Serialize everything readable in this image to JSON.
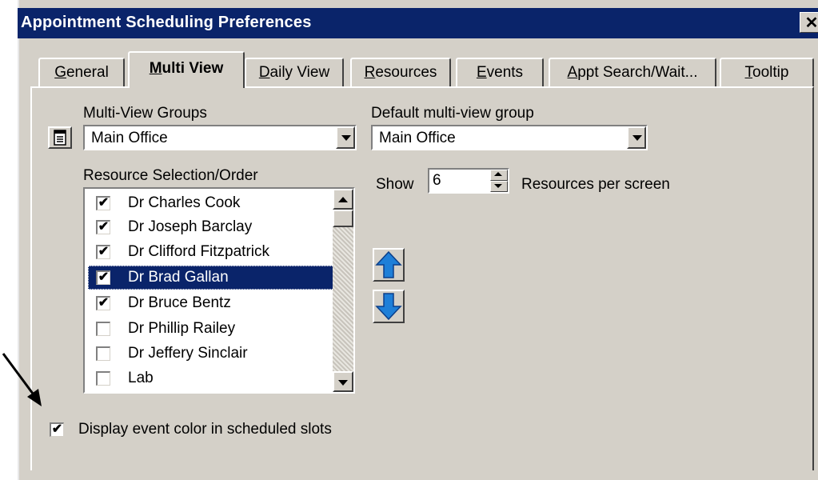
{
  "window": {
    "title": "Appointment Scheduling Preferences",
    "close_label": "✕"
  },
  "tabs": [
    {
      "label": "General",
      "mnemonic": "G",
      "rest": "eneral",
      "active": false
    },
    {
      "label": "Multi View",
      "mnemonic": "M",
      "rest": "ulti View",
      "active": true
    },
    {
      "label": "Daily View",
      "mnemonic": "D",
      "rest": "aily View",
      "active": false
    },
    {
      "label": "Resources",
      "mnemonic": "R",
      "rest": "esources",
      "active": false
    },
    {
      "label": "Events",
      "mnemonic": "E",
      "rest": "vents",
      "active": false
    },
    {
      "label": "Appt Search/Wait...",
      "mnemonic": "A",
      "rest": "ppt Search/Wait...",
      "active": false
    },
    {
      "label": "Tooltip",
      "mnemonic": "T",
      "rest": "ooltip",
      "active": false
    }
  ],
  "multi_view_groups": {
    "label": "Multi-View Groups",
    "value": "Main Office",
    "icon": "list-edit-icon"
  },
  "default_group": {
    "label": "Default multi-view group",
    "value": "Main Office"
  },
  "resource_selection": {
    "label": "Resource Selection/Order",
    "items": [
      {
        "label": "Dr Charles Cook",
        "checked": true,
        "selected": false
      },
      {
        "label": "Dr Joseph Barclay",
        "checked": true,
        "selected": false
      },
      {
        "label": "Dr Clifford Fitzpatrick",
        "checked": true,
        "selected": false
      },
      {
        "label": "Dr Brad Gallan",
        "checked": true,
        "selected": true
      },
      {
        "label": "Dr Bruce Bentz",
        "checked": true,
        "selected": false
      },
      {
        "label": "Dr Phillip Railey",
        "checked": false,
        "selected": false
      },
      {
        "label": "Dr Jeffery Sinclair",
        "checked": false,
        "selected": false
      },
      {
        "label": "Lab",
        "checked": false,
        "selected": false
      }
    ]
  },
  "show_resources": {
    "prefix": "Show",
    "value": "6",
    "suffix": "Resources per screen"
  },
  "move_buttons": {
    "up_icon": "blue-arrow-up-icon",
    "down_icon": "blue-arrow-down-icon",
    "up_color": "#1e7fd8",
    "down_color": "#1e7fd8"
  },
  "display_event_color": {
    "label": "Display event color in scheduled slots",
    "checked": true
  },
  "colors": {
    "titlebar": "#0a246a",
    "dialog": "#d4d0c8",
    "selection": "#0a246a"
  }
}
